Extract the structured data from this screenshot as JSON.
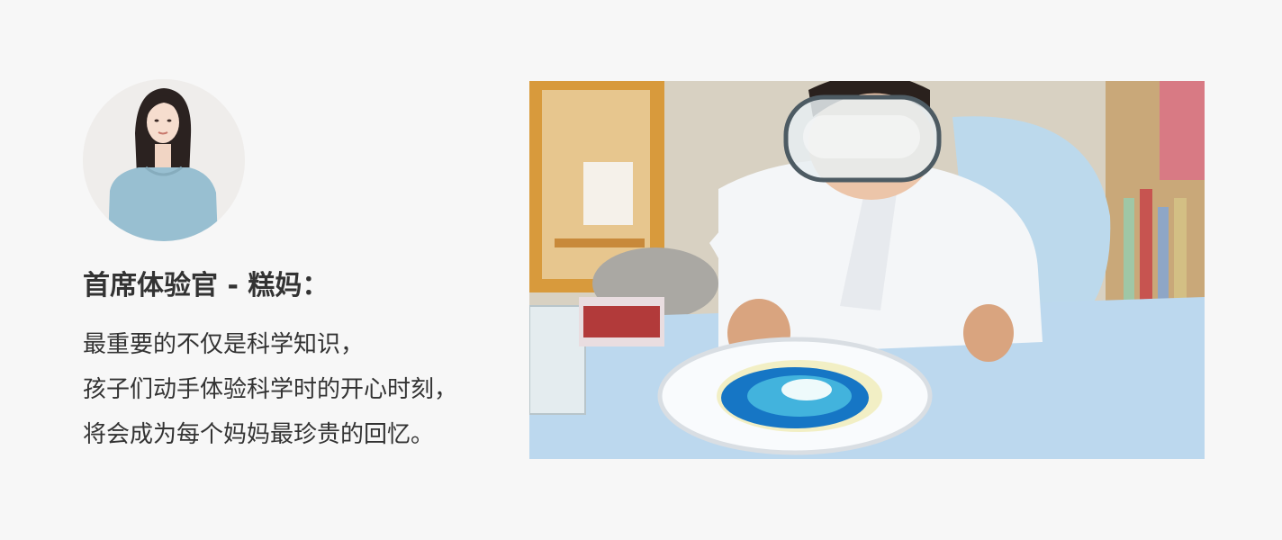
{
  "testimonial": {
    "title": "首席体验官 - 糕妈：",
    "lines": [
      "最重要的不仅是科学知识，",
      "孩子们动手体验科学时的开心时刻，",
      "将会成为每个妈妈最珍贵的回忆。"
    ]
  },
  "colors": {
    "background": "#f7f7f7",
    "text": "#333333",
    "table": "#bcd8ee",
    "coat": "#f4f6f8"
  }
}
